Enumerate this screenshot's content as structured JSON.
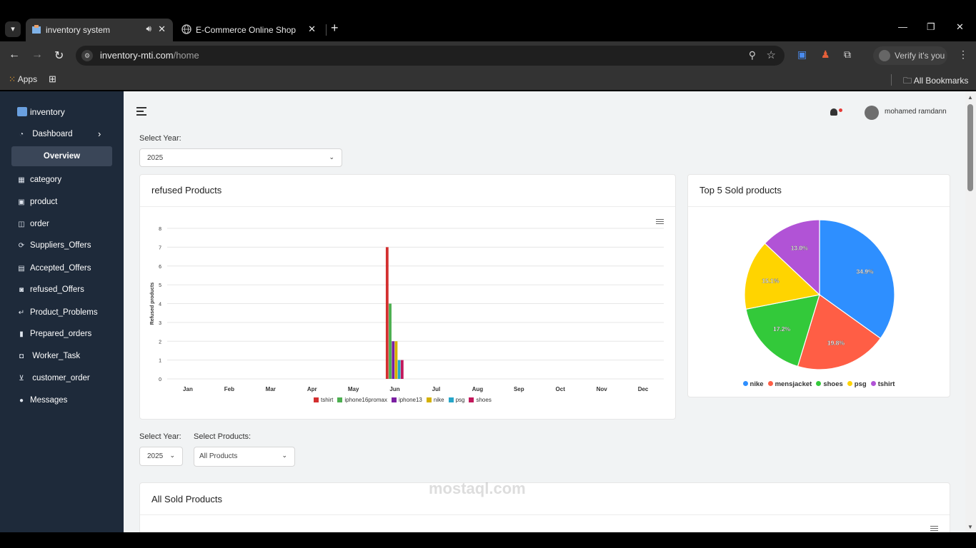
{
  "browser": {
    "tabs": [
      {
        "title": "inventory system",
        "active": true
      },
      {
        "title": "E-Commerce Online Shop",
        "active": false
      }
    ],
    "url_host": "inventory-mti.com",
    "url_path": "/home",
    "verify_label": "Verify it's you",
    "bookmarks": {
      "apps": "Apps",
      "all": "All Bookmarks"
    }
  },
  "sidebar": {
    "brand": "inventory",
    "dashboard": "Dashboard",
    "overview": "Overview",
    "items": [
      {
        "label": "category",
        "icon": "grid-icon"
      },
      {
        "label": "product",
        "icon": "box-icon"
      },
      {
        "label": "order",
        "icon": "bag-icon"
      },
      {
        "label": "Suppliers_Offers",
        "icon": "sync-icon"
      },
      {
        "label": "Accepted_Offers",
        "icon": "calendar-icon"
      },
      {
        "label": "refused_Offers",
        "icon": "lock-icon"
      },
      {
        "label": "Product_Problems",
        "icon": "return-icon"
      },
      {
        "label": "Prepared_orders",
        "icon": "bookmark-icon"
      },
      {
        "label": "Worker_Task",
        "icon": "task-icon"
      },
      {
        "label": "customer_order",
        "icon": "cart-icon"
      },
      {
        "label": "Messages",
        "icon": "chat-icon"
      }
    ]
  },
  "header": {
    "username": "mohamed ramdann"
  },
  "filters": {
    "top_label": "Select Year:",
    "top_year": "2025",
    "bottom_year_label": "Select Year:",
    "bottom_year": "2025",
    "products_label": "Select Products:",
    "products_value": "All Products"
  },
  "cards": {
    "refused_title": "refused Products",
    "top5_title": "Top 5 Sold products",
    "all_sold_title": "All Sold Products"
  },
  "watermark": "mostaql.com",
  "colors": {
    "sidebar_bg": "#1e2a3a",
    "overview_bg": "#3a4658"
  },
  "chart_data": [
    {
      "type": "bar",
      "title": "refused Products",
      "ylabel": "Refused products",
      "ylim": [
        0,
        8
      ],
      "yticks": [
        0,
        1,
        2,
        3,
        4,
        5,
        6,
        7,
        8
      ],
      "categories": [
        "Jan",
        "Feb",
        "Mar",
        "Apr",
        "May",
        "Jun",
        "Jul",
        "Aug",
        "Sep",
        "Oct",
        "Nov",
        "Dec"
      ],
      "series": [
        {
          "name": "tshirt",
          "color": "#d32f2f",
          "values": [
            0,
            0,
            0,
            0,
            0,
            7,
            0,
            0,
            0,
            0,
            0,
            0
          ]
        },
        {
          "name": "iphone16promax",
          "color": "#4caf50",
          "values": [
            0,
            0,
            0,
            0,
            0,
            4,
            0,
            0,
            0,
            0,
            0,
            0
          ]
        },
        {
          "name": "iphone13",
          "color": "#7b1fa2",
          "values": [
            0,
            0,
            0,
            0,
            0,
            2,
            0,
            0,
            0,
            0,
            0,
            0
          ]
        },
        {
          "name": "nike",
          "color": "#d4b000",
          "values": [
            0,
            0,
            0,
            0,
            0,
            2,
            0,
            0,
            0,
            0,
            0,
            0
          ]
        },
        {
          "name": "psg",
          "color": "#26a6c9",
          "values": [
            0,
            0,
            0,
            0,
            0,
            1,
            0,
            0,
            0,
            0,
            0,
            0
          ]
        },
        {
          "name": "shoes",
          "color": "#c2185b",
          "values": [
            0,
            0,
            0,
            0,
            0,
            1,
            0,
            0,
            0,
            0,
            0,
            0
          ]
        }
      ]
    },
    {
      "type": "pie",
      "title": "Top 5 Sold products",
      "labels": [
        "nike",
        "mensjacket",
        "shoes",
        "psg",
        "tshirt"
      ],
      "values": [
        34.9,
        19.8,
        17.2,
        15.1,
        13.0
      ],
      "value_labels": [
        "34.9%",
        "19.8%",
        "17.2%",
        "15.1%",
        "13.0%"
      ],
      "colors": [
        "#2e8fff",
        "#ff5e45",
        "#33c93a",
        "#ffd400",
        "#b153d6"
      ]
    }
  ]
}
